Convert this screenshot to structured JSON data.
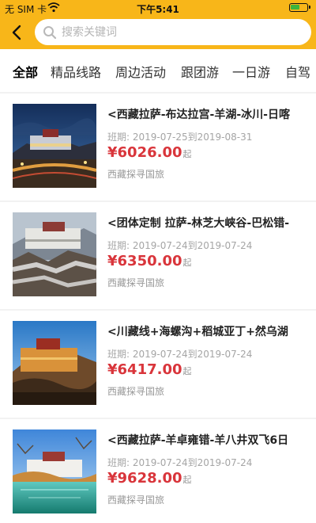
{
  "status_bar": {
    "carrier": "无 SIM 卡",
    "time": "下午5:41",
    "battery_level": 0.6
  },
  "header": {
    "back_icon": "chevron-left-icon",
    "search_icon": "search-icon",
    "search_placeholder": "搜索关键词"
  },
  "colors": {
    "brand": "#f8b619",
    "price": "#d9353b"
  },
  "tabs": [
    {
      "label": "全部",
      "active": true
    },
    {
      "label": "精品线路"
    },
    {
      "label": "周边活动"
    },
    {
      "label": "跟团游"
    },
    {
      "label": "一日游"
    },
    {
      "label": "自驾"
    }
  ],
  "products": [
    {
      "title": "<西藏拉萨-布达拉宫-羊湖-冰川-日喀",
      "schedule": "班期: 2019-07-25到2019-08-31",
      "price": "¥6026.00",
      "price_suffix": "起",
      "agency": "西藏探寻国旅"
    },
    {
      "title": "<团体定制 拉萨-林芝大峡谷-巴松错-",
      "schedule": "班期: 2019-07-24到2019-07-24",
      "price": "¥6350.00",
      "price_suffix": "起",
      "agency": "西藏探寻国旅"
    },
    {
      "title": "<川藏线+海螺沟+稻城亚丁+然乌湖",
      "schedule": "班期: 2019-07-24到2019-07-24",
      "price": "¥6417.00",
      "price_suffix": "起",
      "agency": "西藏探寻国旅"
    },
    {
      "title": "<西藏拉萨-羊卓雍错-羊八井双飞6日",
      "schedule": "班期: 2019-07-24到2019-07-24",
      "price": "¥9628.00",
      "price_suffix": "起",
      "agency": "西藏探寻国旅"
    }
  ]
}
